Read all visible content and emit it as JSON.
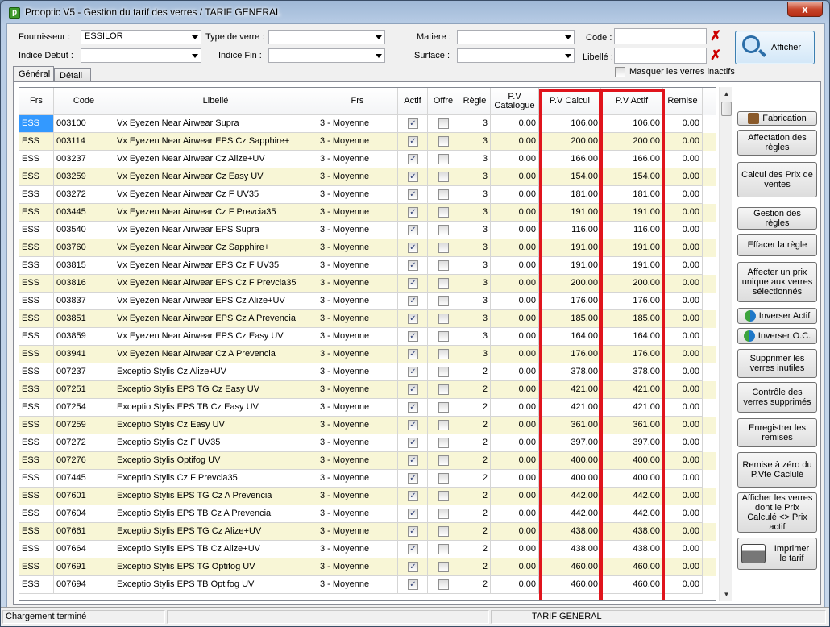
{
  "window": {
    "title": "Prooptic V5 - Gestion du tarif des verres / TARIF GENERAL",
    "close": "x"
  },
  "filters": {
    "fournisseur_label": "Fournisseur :",
    "fournisseur_value": "ESSILOR",
    "type_label": "Type de verre :",
    "type_value": "",
    "matiere_label": "Matiere :",
    "matiere_value": "",
    "code_label": "Code :",
    "code_value": "",
    "indice_debut_label": "Indice Debut :",
    "indice_debut_value": "",
    "indice_fin_label": "Indice Fin :",
    "indice_fin_value": "",
    "surface_label": "Surface :",
    "surface_value": "",
    "libelle_label": "Libellé :",
    "libelle_value": "",
    "masquer_label": "Masquer les verres inactifs",
    "afficher_label": "Afficher",
    "clear_glyph": "✗"
  },
  "tabs": [
    {
      "label": "Général"
    },
    {
      "label": "Détail"
    }
  ],
  "grid": {
    "headers": [
      "Frs",
      "Code",
      "Libellé",
      "Frs",
      "Actif",
      "Offre",
      "Règle",
      "P.V Catalogue",
      "P.V Calcul",
      "P.V Actif",
      "Remise"
    ],
    "check": "✓",
    "rows": [
      [
        "ESS",
        "003100",
        "Vx Eyezen Near Airwear Supra",
        "3 - Moyenne",
        "3",
        "0.00",
        "106.00",
        "106.00",
        "0.00"
      ],
      [
        "ESS",
        "003114",
        "Vx Eyezen Near Airwear EPS Cz Sapphire+",
        "3 - Moyenne",
        "3",
        "0.00",
        "200.00",
        "200.00",
        "0.00"
      ],
      [
        "ESS",
        "003237",
        "Vx Eyezen Near Airwear Cz Alize+UV",
        "3 - Moyenne",
        "3",
        "0.00",
        "166.00",
        "166.00",
        "0.00"
      ],
      [
        "ESS",
        "003259",
        "Vx Eyezen Near Airwear Cz Easy UV",
        "3 - Moyenne",
        "3",
        "0.00",
        "154.00",
        "154.00",
        "0.00"
      ],
      [
        "ESS",
        "003272",
        "Vx Eyezen Near Airwear Cz F UV35",
        "3 - Moyenne",
        "3",
        "0.00",
        "181.00",
        "181.00",
        "0.00"
      ],
      [
        "ESS",
        "003445",
        "Vx Eyezen Near Airwear Cz F Prevcia35",
        "3 - Moyenne",
        "3",
        "0.00",
        "191.00",
        "191.00",
        "0.00"
      ],
      [
        "ESS",
        "003540",
        "Vx Eyezen Near Airwear EPS Supra",
        "3 - Moyenne",
        "3",
        "0.00",
        "116.00",
        "116.00",
        "0.00"
      ],
      [
        "ESS",
        "003760",
        "Vx Eyezen Near Airwear Cz Sapphire+",
        "3 - Moyenne",
        "3",
        "0.00",
        "191.00",
        "191.00",
        "0.00"
      ],
      [
        "ESS",
        "003815",
        "Vx Eyezen Near Airwear EPS Cz F UV35",
        "3 - Moyenne",
        "3",
        "0.00",
        "191.00",
        "191.00",
        "0.00"
      ],
      [
        "ESS",
        "003816",
        "Vx Eyezen Near Airwear EPS Cz F Prevcia35",
        "3 - Moyenne",
        "3",
        "0.00",
        "200.00",
        "200.00",
        "0.00"
      ],
      [
        "ESS",
        "003837",
        "Vx Eyezen Near Airwear EPS Cz Alize+UV",
        "3 - Moyenne",
        "3",
        "0.00",
        "176.00",
        "176.00",
        "0.00"
      ],
      [
        "ESS",
        "003851",
        "Vx Eyezen Near Airwear EPS Cz A Prevencia",
        "3 - Moyenne",
        "3",
        "0.00",
        "185.00",
        "185.00",
        "0.00"
      ],
      [
        "ESS",
        "003859",
        "Vx Eyezen Near Airwear EPS Cz Easy UV",
        "3 - Moyenne",
        "3",
        "0.00",
        "164.00",
        "164.00",
        "0.00"
      ],
      [
        "ESS",
        "003941",
        "Vx Eyezen Near Airwear Cz A Prevencia",
        "3 - Moyenne",
        "3",
        "0.00",
        "176.00",
        "176.00",
        "0.00"
      ],
      [
        "ESS",
        "007237",
        "Exceptio Stylis Cz Alize+UV",
        "3 - Moyenne",
        "2",
        "0.00",
        "378.00",
        "378.00",
        "0.00"
      ],
      [
        "ESS",
        "007251",
        "Exceptio Stylis EPS TG Cz Easy UV",
        "3 - Moyenne",
        "2",
        "0.00",
        "421.00",
        "421.00",
        "0.00"
      ],
      [
        "ESS",
        "007254",
        "Exceptio Stylis EPS TB Cz Easy UV",
        "3 - Moyenne",
        "2",
        "0.00",
        "421.00",
        "421.00",
        "0.00"
      ],
      [
        "ESS",
        "007259",
        "Exceptio Stylis Cz Easy UV",
        "3 - Moyenne",
        "2",
        "0.00",
        "361.00",
        "361.00",
        "0.00"
      ],
      [
        "ESS",
        "007272",
        "Exceptio Stylis Cz F UV35",
        "3 - Moyenne",
        "2",
        "0.00",
        "397.00",
        "397.00",
        "0.00"
      ],
      [
        "ESS",
        "007276",
        "Exceptio Stylis Optifog UV",
        "3 - Moyenne",
        "2",
        "0.00",
        "400.00",
        "400.00",
        "0.00"
      ],
      [
        "ESS",
        "007445",
        "Exceptio Stylis Cz F Prevcia35",
        "3 - Moyenne",
        "2",
        "0.00",
        "400.00",
        "400.00",
        "0.00"
      ],
      [
        "ESS",
        "007601",
        "Exceptio Stylis EPS TG Cz A Prevencia",
        "3 - Moyenne",
        "2",
        "0.00",
        "442.00",
        "442.00",
        "0.00"
      ],
      [
        "ESS",
        "007604",
        "Exceptio Stylis EPS TB Cz A Prevencia",
        "3 - Moyenne",
        "2",
        "0.00",
        "442.00",
        "442.00",
        "0.00"
      ],
      [
        "ESS",
        "007661",
        "Exceptio Stylis EPS TG Cz Alize+UV",
        "3 - Moyenne",
        "2",
        "0.00",
        "438.00",
        "438.00",
        "0.00"
      ],
      [
        "ESS",
        "007664",
        "Exceptio Stylis EPS TB Cz Alize+UV",
        "3 - Moyenne",
        "2",
        "0.00",
        "438.00",
        "438.00",
        "0.00"
      ],
      [
        "ESS",
        "007691",
        "Exceptio Stylis EPS TG Optifog UV",
        "3 - Moyenne",
        "2",
        "0.00",
        "460.00",
        "460.00",
        "0.00"
      ],
      [
        "ESS",
        "007694",
        "Exceptio Stylis EPS TB Optifog UV",
        "3 - Moyenne",
        "2",
        "0.00",
        "460.00",
        "460.00",
        "0.00"
      ]
    ]
  },
  "side_buttons": [
    {
      "name": "fabrication-button",
      "label": "Fabrication",
      "icon": "fabrication-icon"
    },
    {
      "name": "affectation-regles-button",
      "label": "Affectation des règles"
    },
    {
      "name": "calcul-prix-ventes-button",
      "label": "Calcul des Prix de ventes"
    },
    {
      "name": "gestion-regles-button",
      "label": "Gestion des règles"
    },
    {
      "name": "effacer-regle-button",
      "label": "Effacer la règle"
    },
    {
      "name": "affecter-prix-unique-button",
      "label": "Affecter un prix unique aux verres sélectionnés"
    },
    {
      "name": "inverser-actif-button",
      "label": "Inverser Actif",
      "icon": "swap-icon"
    },
    {
      "name": "inverser-oc-button",
      "label": "Inverser O.C.",
      "icon": "swap-icon"
    },
    {
      "name": "supprimer-verres-inutiles-button",
      "label": "Supprimer les verres inutiles"
    },
    {
      "name": "controle-verres-supprimes-button",
      "label": "Contrôle des verres supprimés"
    },
    {
      "name": "enregistrer-remises-button",
      "label": "Enregistrer les remises"
    },
    {
      "name": "remise-zero-button",
      "label": "Remise à zéro du P.Vte Caclulé"
    },
    {
      "name": "afficher-verres-prix-button",
      "label": "Afficher les verres dont le Prix Calculé <> Prix actif"
    },
    {
      "name": "imprimer-tarif-button",
      "label": "Imprimer le tarif",
      "icon": "printer-icon"
    }
  ],
  "status": {
    "left": "Chargement terminé",
    "right": "TARIF GENERAL"
  },
  "colors": {
    "selected": "#3399ff",
    "alt_row": "#f8f6d6",
    "highlight": "#e0141c"
  }
}
